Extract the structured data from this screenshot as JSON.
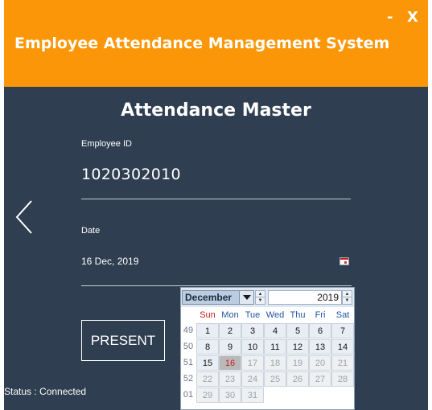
{
  "window": {
    "title": "Employee Attendance Management System",
    "minimize_label": "-",
    "close_label": "X"
  },
  "page": {
    "title": "Attendance Master",
    "back_icon": "chevron-left-icon"
  },
  "form": {
    "employee_id_label": "Employee ID",
    "employee_id_value": "1020302010",
    "date_label": "Date",
    "date_value": "16 Dec, 2019",
    "present_button": "PRESENT"
  },
  "status": {
    "text": "Status : Connected"
  },
  "calendar": {
    "month": "December",
    "year": "2019",
    "weekdays": [
      "Sun",
      "Mon",
      "Tue",
      "Wed",
      "Thu",
      "Fri",
      "Sat"
    ],
    "weeks": [
      {
        "num": "49",
        "days": [
          "1",
          "2",
          "3",
          "4",
          "5",
          "6",
          "7"
        ]
      },
      {
        "num": "50",
        "days": [
          "8",
          "9",
          "10",
          "11",
          "12",
          "13",
          "14"
        ]
      },
      {
        "num": "51",
        "days": [
          "15",
          "16",
          "17",
          "18",
          "19",
          "20",
          "21"
        ]
      },
      {
        "num": "52",
        "days": [
          "22",
          "23",
          "24",
          "25",
          "26",
          "27",
          "28"
        ]
      },
      {
        "num": "01",
        "days": [
          "29",
          "30",
          "31"
        ]
      }
    ],
    "selected_day": "16",
    "colors": {
      "header": "#fb9608",
      "background": "#2f3e50",
      "selected_text": "#c02020"
    }
  }
}
